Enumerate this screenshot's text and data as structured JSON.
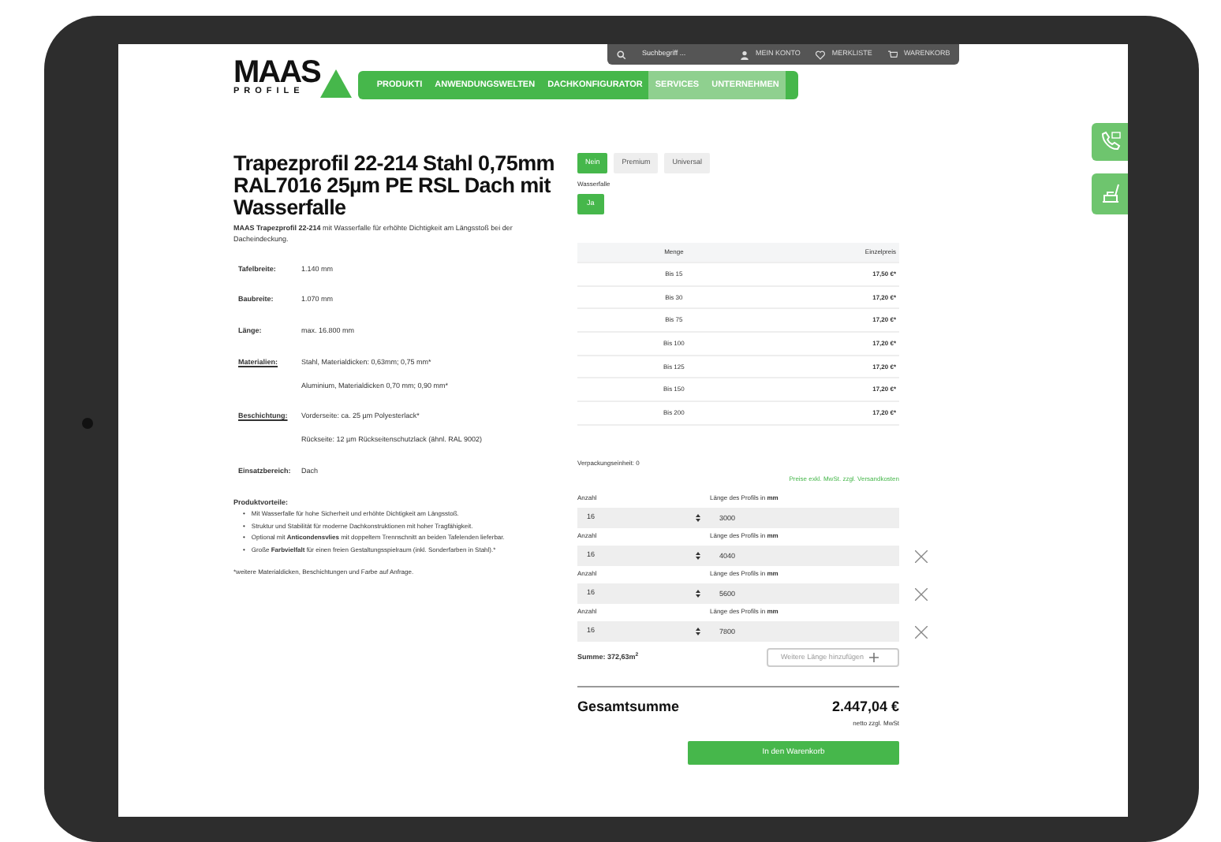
{
  "topbar": {
    "search_placeholder": "Suchbegriff ...",
    "links": [
      "MEIN KONTO",
      "MERKLISTE",
      "WARENKORB"
    ]
  },
  "logo": {
    "main": "MAAS",
    "sub": "PROFILE"
  },
  "nav": [
    {
      "label": "PRODUKTI",
      "highlighted": false
    },
    {
      "label": "ANWENDUNGSWELTEN",
      "highlighted": false
    },
    {
      "label": "DACHKONFIGURATOR",
      "highlighted": false
    },
    {
      "label": "SERVICES",
      "highlighted": true
    },
    {
      "label": "UNTERNEHMEN",
      "highlighted": true
    }
  ],
  "product": {
    "title": "Trapezprofil 22-214 Stahl 0,75mm RAL7016 25µm PE RSL Dach mit Wasserfalle",
    "intro": "**MAAS Trapezprofil 22-214** mit Wasserfalle für erhöhte Dichtigkeit am Längsstoß bei der Dacheindeckung.",
    "specs": [
      {
        "label": "Tafelbreite:",
        "kind": "plain",
        "values": [
          "1.140 mm"
        ]
      },
      {
        "label": "Baubreite:",
        "kind": "plain",
        "values": [
          "1.070 mm"
        ]
      },
      {
        "label": "Länge:",
        "kind": "plain",
        "values": [
          "max. 16.800 mm"
        ]
      },
      {
        "label": "Materialien:",
        "kind": "link",
        "values": [
          "Stahl, Materialdicken: 0,63mm; 0,75 mm*",
          "Aluminium, Materialdicken 0,70 mm; 0,90 mm*"
        ]
      },
      {
        "label": "Beschichtung:",
        "kind": "link",
        "values": [
          "Vorderseite: ca. 25 µm Polyesterlack*",
          "Rückseite: 12 µm Rückseitenschutzlack (ähnl. RAL 9002)"
        ]
      },
      {
        "label": "Einsatzbereich:",
        "kind": "plain",
        "values": [
          "Dach"
        ]
      }
    ],
    "advantages_heading": "Produktvorteile:",
    "advantages": [
      {
        "marker": "•",
        "text": "Mit Wasserfalle für hohe Sicherheit und erhöhte Dichtigkeit am Längsstoß."
      },
      {
        "marker": "•",
        "text": "Struktur und Stabilität für moderne Dachkonstruktionen mit hoher Tragfähigkeit."
      },
      {
        "marker": "•",
        "text": "Optional mit **Anticondensvlies** mit doppeltem Trennschnitt an beiden Tafelenden lieferbar."
      },
      {
        "marker": "•",
        "text": "Große **Farbvielfalt** für einen freien Gestaltungsspielraum (inkl. Sonderfarben in Stahl).*"
      }
    ],
    "footnote": "*weitere Materialdicken, Beschichtungen und Farbe auf Anfrage."
  },
  "options": [
    {
      "label": "Nein",
      "selected": true
    },
    {
      "label": "Premium",
      "selected": false
    },
    {
      "label": "Universal",
      "selected": false
    }
  ],
  "wasserfalle": {
    "label": "Wasserfalle",
    "options": [
      {
        "label": "Ja",
        "selected": true
      }
    ]
  },
  "price_table": {
    "columns": [
      "Menge",
      "Einzelpreis"
    ],
    "rows": [
      [
        "Bis 15",
        "17,50 €*"
      ],
      [
        "Bis 30",
        "17,20 €*"
      ],
      [
        "Bis 75",
        "17,20 €*"
      ],
      [
        "Bis 100",
        "17,20 €*"
      ],
      [
        "Bis 125",
        "17,20 €*"
      ],
      [
        "Bis 150",
        "17,20 €*"
      ],
      [
        "Bis 200",
        "17,20 €*"
      ]
    ]
  },
  "packaging": "Verpackungseinheit: 0",
  "price_note": "Preise exkl. MwSt. zzgl. Versandkosten",
  "lengths": [
    {
      "qty_label": "Anzahl",
      "qty": "16",
      "length_label": "Länge des Profils in **mm**",
      "length": "3000",
      "removable": false
    },
    {
      "qty_label": "Anzahl",
      "qty": "16",
      "length_label": "Länge des Profils in **mm**",
      "length": "4040",
      "removable": true
    },
    {
      "qty_label": "Anzahl",
      "qty": "16",
      "length_label": "Länge des Profils in **mm**",
      "length": "5600",
      "removable": true
    },
    {
      "qty_label": "Anzahl",
      "qty": "16",
      "length_label": "Länge des Profils in **mm**",
      "length": "7800",
      "removable": true
    }
  ],
  "sum": "Summe: 372,63m$^{2}$",
  "add_button": "Weitere Länge hinzufügen",
  "total": {
    "label": "Gesamtsumme",
    "amount": "2.447,04 €",
    "note": "netto zzgl. MwSt"
  },
  "cart_button": "In den Warenkorb"
}
